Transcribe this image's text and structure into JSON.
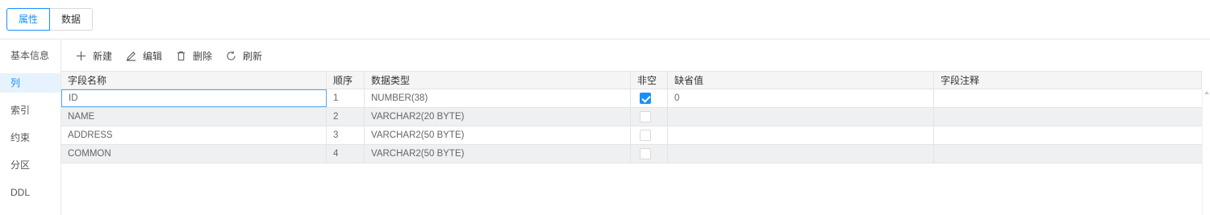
{
  "tabs": [
    {
      "label": "属性",
      "active": true
    },
    {
      "label": "数据",
      "active": false
    }
  ],
  "sidebar": {
    "items": [
      {
        "label": "基本信息",
        "active": false
      },
      {
        "label": "列",
        "active": true
      },
      {
        "label": "索引",
        "active": false
      },
      {
        "label": "约束",
        "active": false
      },
      {
        "label": "分区",
        "active": false
      },
      {
        "label": "DDL",
        "active": false
      }
    ]
  },
  "toolbar": {
    "new_label": "新建",
    "edit_label": "编辑",
    "delete_label": "删除",
    "refresh_label": "刷新"
  },
  "table": {
    "columns": [
      "字段名称",
      "顺序",
      "数据类型",
      "非空",
      "缺省值",
      "字段注释"
    ],
    "rows": [
      {
        "name": "ID",
        "order": "1",
        "type": "NUMBER(38)",
        "not_null": true,
        "default": "0",
        "comment": ""
      },
      {
        "name": "NAME",
        "order": "2",
        "type": "VARCHAR2(20 BYTE)",
        "not_null": false,
        "default": "",
        "comment": ""
      },
      {
        "name": "ADDRESS",
        "order": "3",
        "type": "VARCHAR2(50 BYTE)",
        "not_null": false,
        "default": "",
        "comment": ""
      },
      {
        "name": "COMMON",
        "order": "4",
        "type": "VARCHAR2(50 BYTE)",
        "not_null": false,
        "default": "",
        "comment": ""
      }
    ]
  },
  "colors": {
    "accent": "#1890ff",
    "active_nav_bg": "#e6f3ff",
    "alt_row_bg": "#eef0f2"
  }
}
